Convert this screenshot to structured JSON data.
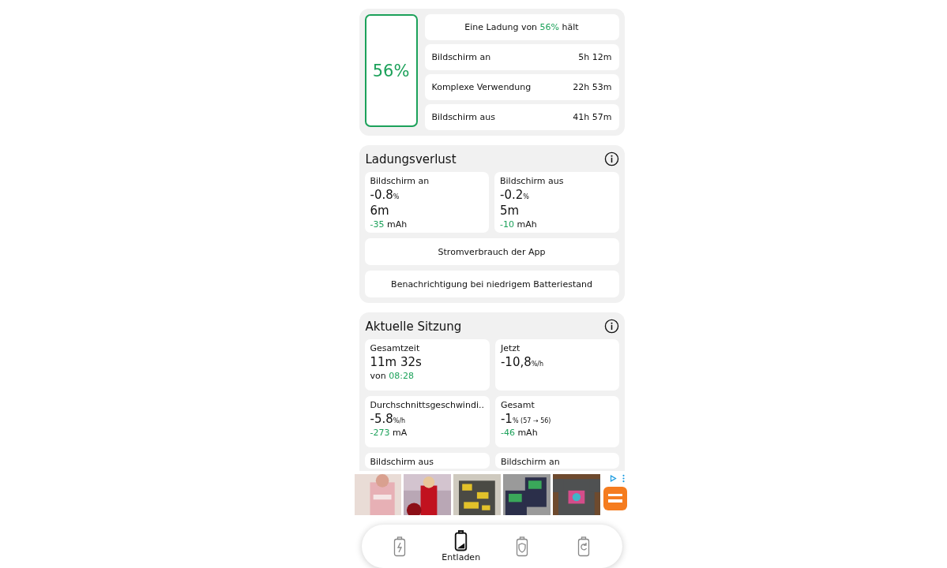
{
  "charge_summary": {
    "level_text": "56%",
    "headline": {
      "before": "Eine Ladung von",
      "highlight": "56%",
      "after": "hält"
    },
    "rows": [
      {
        "label": "Bildschirm an",
        "value": "5h 12m"
      },
      {
        "label": "Komplexe Verwendung",
        "value": "22h 53m"
      },
      {
        "label": "Bildschirm aus",
        "value": "41h 57m"
      }
    ]
  },
  "charge_loss": {
    "title": "Ladungsverlust",
    "cards": [
      {
        "title": "Bildschirm an",
        "value": "-0.8",
        "unit": "%",
        "duration": "6m",
        "sub": {
          "highlight": "-35",
          "trail": "mAh"
        }
      },
      {
        "title": "Bildschirm aus",
        "value": "-0.2",
        "unit": "%",
        "duration": "5m",
        "sub": {
          "highlight": "-10",
          "trail": "mAh"
        }
      }
    ],
    "buttons": [
      "Stromverbrauch der App",
      "Benachrichtigung bei niedrigem Batteriestand"
    ]
  },
  "session": {
    "title": "Aktuelle Sitzung",
    "cards": [
      {
        "title": "Gesamtzeit",
        "value": "11m 32s",
        "sub": {
          "lead": "von",
          "highlight": "08:28"
        }
      },
      {
        "title": "Jetzt",
        "value": "-10,8",
        "unit": "%/h"
      },
      {
        "title": "Durchschnittsgeschwindi..",
        "value": "-5.8",
        "unit": "%/h",
        "sub": {
          "highlight": "-273",
          "trail": "mA"
        }
      },
      {
        "title": "Gesamt",
        "value": "-1",
        "unit": "% (57 → 56)",
        "sub": {
          "highlight": "-46",
          "trail": "mAh"
        }
      },
      {
        "title": "Bildschirm aus"
      },
      {
        "title": "Bildschirm an"
      }
    ]
  },
  "nav": [
    {
      "kind": "charge",
      "selected": false
    },
    {
      "kind": "discharge",
      "label": "Entladen",
      "selected": true
    },
    {
      "kind": "shield",
      "selected": false
    },
    {
      "kind": "cycle",
      "selected": false
    }
  ]
}
